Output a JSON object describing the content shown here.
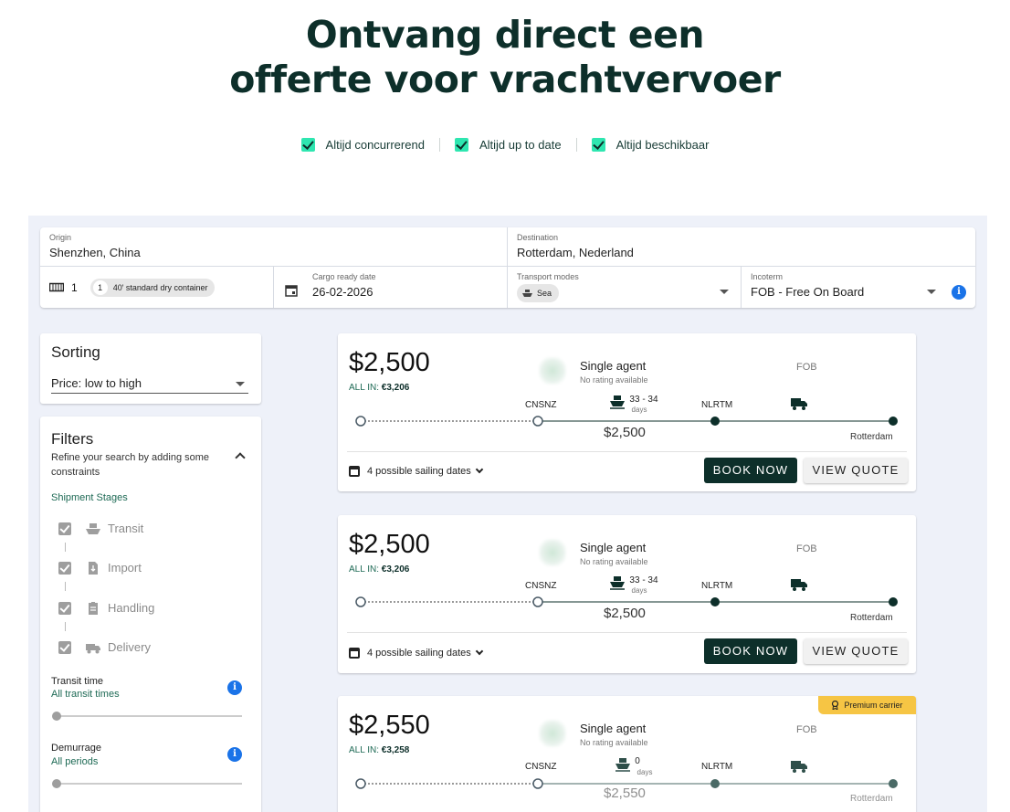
{
  "hero": {
    "title_line1": "Ontvang direct een",
    "title_line2": "offerte voor vrachtvervoer"
  },
  "usps": [
    "Altijd concurrerend",
    "Altijd up to date",
    "Altijd beschikbaar"
  ],
  "colors": {
    "brand_dark": "#0d2f2a",
    "accent_green": "#2ee6b0",
    "panel_bg": "#eef1f9",
    "info_blue": "#1a73e8",
    "premium_yellow": "#f6c544"
  },
  "search": {
    "origin_label": "Origin",
    "origin_value": "Shenzhen, China",
    "destination_label": "Destination",
    "destination_value": "Rotterdam, Nederland",
    "container_count": "1",
    "container_chip_count": "1",
    "container_chip_label": "40' standard dry container",
    "cargo_date_label": "Cargo ready date",
    "cargo_date_value": "26-02-2026",
    "transport_label": "Transport modes",
    "transport_chip": "Sea",
    "incoterm_label": "Incoterm",
    "incoterm_value": "FOB - Free On Board"
  },
  "sorting": {
    "title": "Sorting",
    "value": "Price: low to high"
  },
  "filters": {
    "title": "Filters",
    "description": "Refine your search by adding some constraints",
    "stages_title": "Shipment Stages",
    "stages": [
      {
        "label": "Transit",
        "icon": "ship-icon"
      },
      {
        "label": "Import",
        "icon": "document-icon"
      },
      {
        "label": "Handling",
        "icon": "clipboard-icon"
      },
      {
        "label": "Delivery",
        "icon": "truck-icon"
      }
    ],
    "transit_title": "Transit time",
    "transit_sub": "All transit times",
    "demurrage_title": "Demurrage",
    "demurrage_sub": "All periods"
  },
  "offers": [
    {
      "price": "$2,500",
      "allin_label": "ALL IN:",
      "allin_value": "€3,206",
      "agent": "Single agent",
      "rating": "No rating available",
      "incoterm": "FOB",
      "origin_port": "CNSNZ",
      "days": "33 - 34",
      "days_label": "days",
      "dest_port": "NLRTM",
      "segment_price": "$2,500",
      "dest_city": "Rotterdam",
      "sailing": "4 possible sailing dates",
      "book": "BOOK NOW",
      "view": "VIEW QUOTE"
    },
    {
      "price": "$2,500",
      "allin_label": "ALL IN:",
      "allin_value": "€3,206",
      "agent": "Single agent",
      "rating": "No rating available",
      "incoterm": "FOB",
      "origin_port": "CNSNZ",
      "days": "33 - 34",
      "days_label": "days",
      "dest_port": "NLRTM",
      "segment_price": "$2,500",
      "dest_city": "Rotterdam",
      "sailing": "4 possible sailing dates",
      "book": "BOOK NOW",
      "view": "VIEW QUOTE"
    },
    {
      "price": "$2,550",
      "allin_label": "ALL IN:",
      "allin_value": "€3,258",
      "agent": "Single agent",
      "rating": "No rating available",
      "incoterm": "FOB",
      "origin_port": "CNSNZ",
      "days": "0",
      "days_label": "days",
      "dest_port": "NLRTM",
      "segment_price": "$2,550",
      "dest_city": "Rotterdam",
      "premium": "Premium carrier"
    }
  ]
}
